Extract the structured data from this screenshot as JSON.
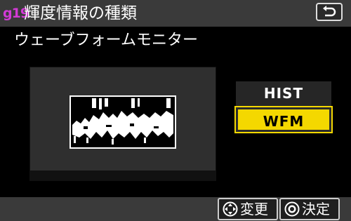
{
  "header": {
    "menu_code": "g19",
    "title": "輝度情報の種類"
  },
  "subtitle": "ウェーブフォームモニター",
  "options": [
    {
      "label": "HIST",
      "selected": false
    },
    {
      "label": "WFM",
      "selected": true
    }
  ],
  "footer": {
    "change_label": "変更",
    "ok_label": "決定"
  },
  "colors": {
    "accent_yellow": "#f4d800",
    "menu_code_magenta": "#d33ad6",
    "bar_gray": "#3a3a3a"
  },
  "icons": {
    "back": "return-arrow-icon",
    "dpad": "multi-selector-icon",
    "ok": "ok-button-icon"
  }
}
